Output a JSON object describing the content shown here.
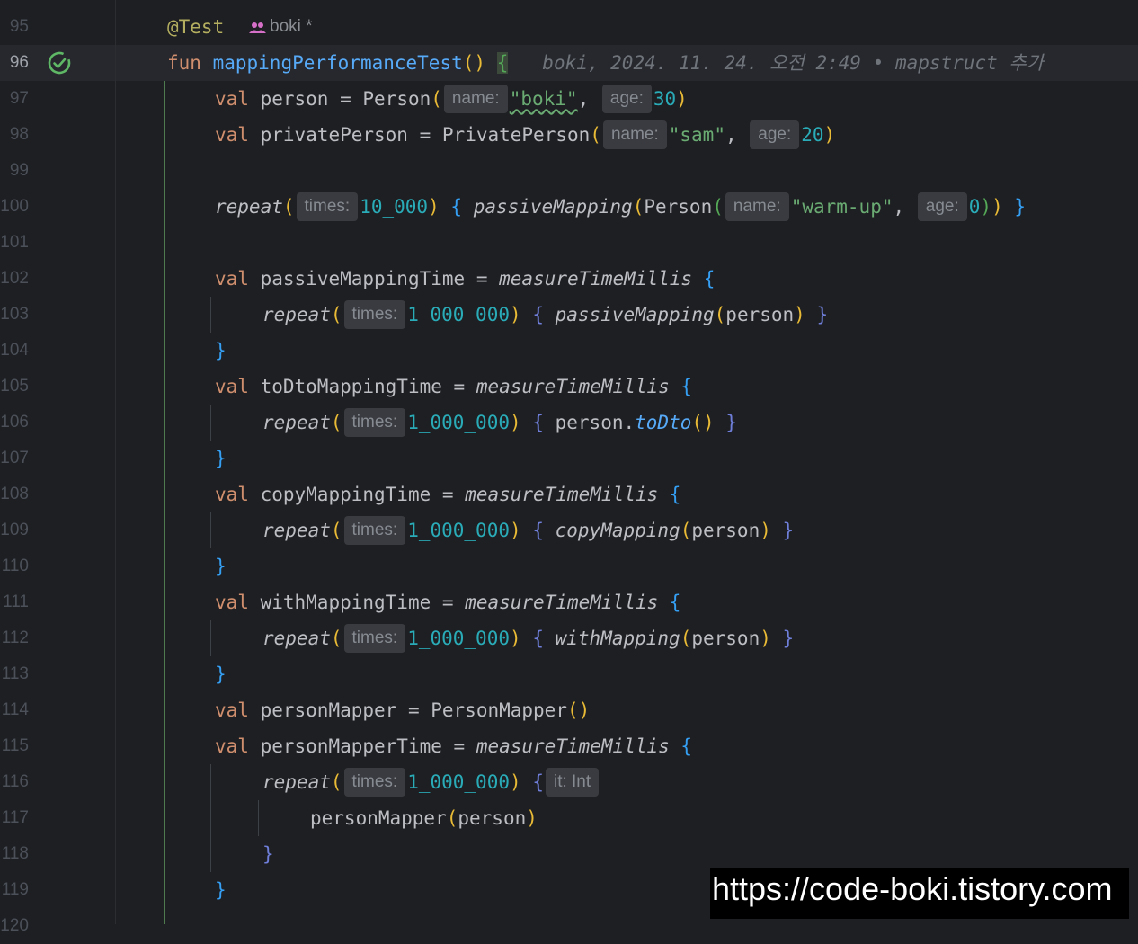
{
  "line_numbers": [
    "95",
    "96",
    "97",
    "98",
    "99",
    "100",
    "101",
    "102",
    "103",
    "104",
    "105",
    "106",
    "107",
    "108",
    "109",
    "110",
    "111",
    "112",
    "113",
    "114",
    "115",
    "116",
    "117",
    "118",
    "119",
    "120"
  ],
  "annotation": "@Test",
  "author_hint": "boki *",
  "blame": "boki, 2024. 11. 24. 오전 2:49 • mapstruct 추가",
  "code": {
    "fun_kw": "fun",
    "fun_name": "mappingPerformanceTest",
    "val_kw": "val",
    "person_var": "person",
    "person_ctor": "Person",
    "name_hint": "name:",
    "age_hint": "age:",
    "times_hint": "times:",
    "it_hint": "it: Int",
    "boki_str": "\"boki\"",
    "age_30": "30",
    "private_var": "privatePerson",
    "private_ctor": "PrivatePerson",
    "sam_str": "\"sam\"",
    "age_20": "20",
    "repeat": "repeat",
    "warm_count": "10_000",
    "passive": "passiveMapping",
    "warm_str": "\"warm-up\"",
    "age_0": "0",
    "passive_time": "passiveMappingTime",
    "measure": "measureTimeMillis",
    "million": "1_000_000",
    "todto_time": "toDtoMappingTime",
    "to_dto": "toDto",
    "copy_time": "copyMappingTime",
    "copy": "copyMapping",
    "with_time": "withMappingTime",
    "with": "withMapping",
    "mapper_var": "personMapper",
    "mapper_ctor": "PersonMapper",
    "mapper_time": "personMapperTime"
  },
  "watermark": "https://code-boki.tistory.com",
  "colors": {
    "background": "#1e1f22",
    "keyword": "#cf8e6d",
    "function": "#57aaf7",
    "string": "#6aab73",
    "number": "#2aacb8",
    "annotation": "#b3ae60"
  },
  "icons": {
    "run_status": "check-circle-icon",
    "author": "people-icon"
  }
}
